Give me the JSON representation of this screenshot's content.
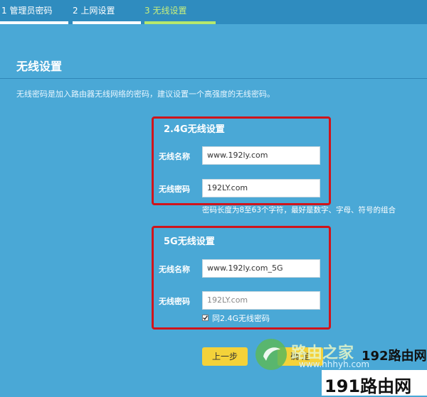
{
  "steps": [
    {
      "label": "1 管理员密码"
    },
    {
      "label": "2 上网设置"
    },
    {
      "label": "3 无线设置"
    }
  ],
  "page": {
    "heading": "无线设置",
    "description": "无线密码是加入路由器无线网络的密码，建议设置一个高强度的无线密码。"
  },
  "band24": {
    "title": "2.4G无线设置",
    "name_label": "无线名称",
    "name_value": "www.192ly.com",
    "password_label": "无线密码",
    "password_value": "192LY.com",
    "hint": "密码长度为8至63个字符，最好是数字、字母、符号的组合"
  },
  "band5": {
    "title": "5G无线设置",
    "name_label": "无线名称",
    "name_value": "www.192ly.com_5G",
    "password_label": "无线密码",
    "password_value": "192LY.com",
    "same_password_label": "同2.4G无线密码",
    "same_password_checked": true
  },
  "buttons": {
    "prev": "上一步",
    "confirm": "确 定"
  },
  "watermark": {
    "text_site": "路由之家",
    "text_url": "www.hhhyh.com",
    "brand_192": "192路由网",
    "brand_191": "191路由网"
  },
  "colors": {
    "background": "#4aa8d6",
    "active_step": "#b6e86c",
    "button": "#f4d23a",
    "highlight_box": "#d0141b"
  }
}
